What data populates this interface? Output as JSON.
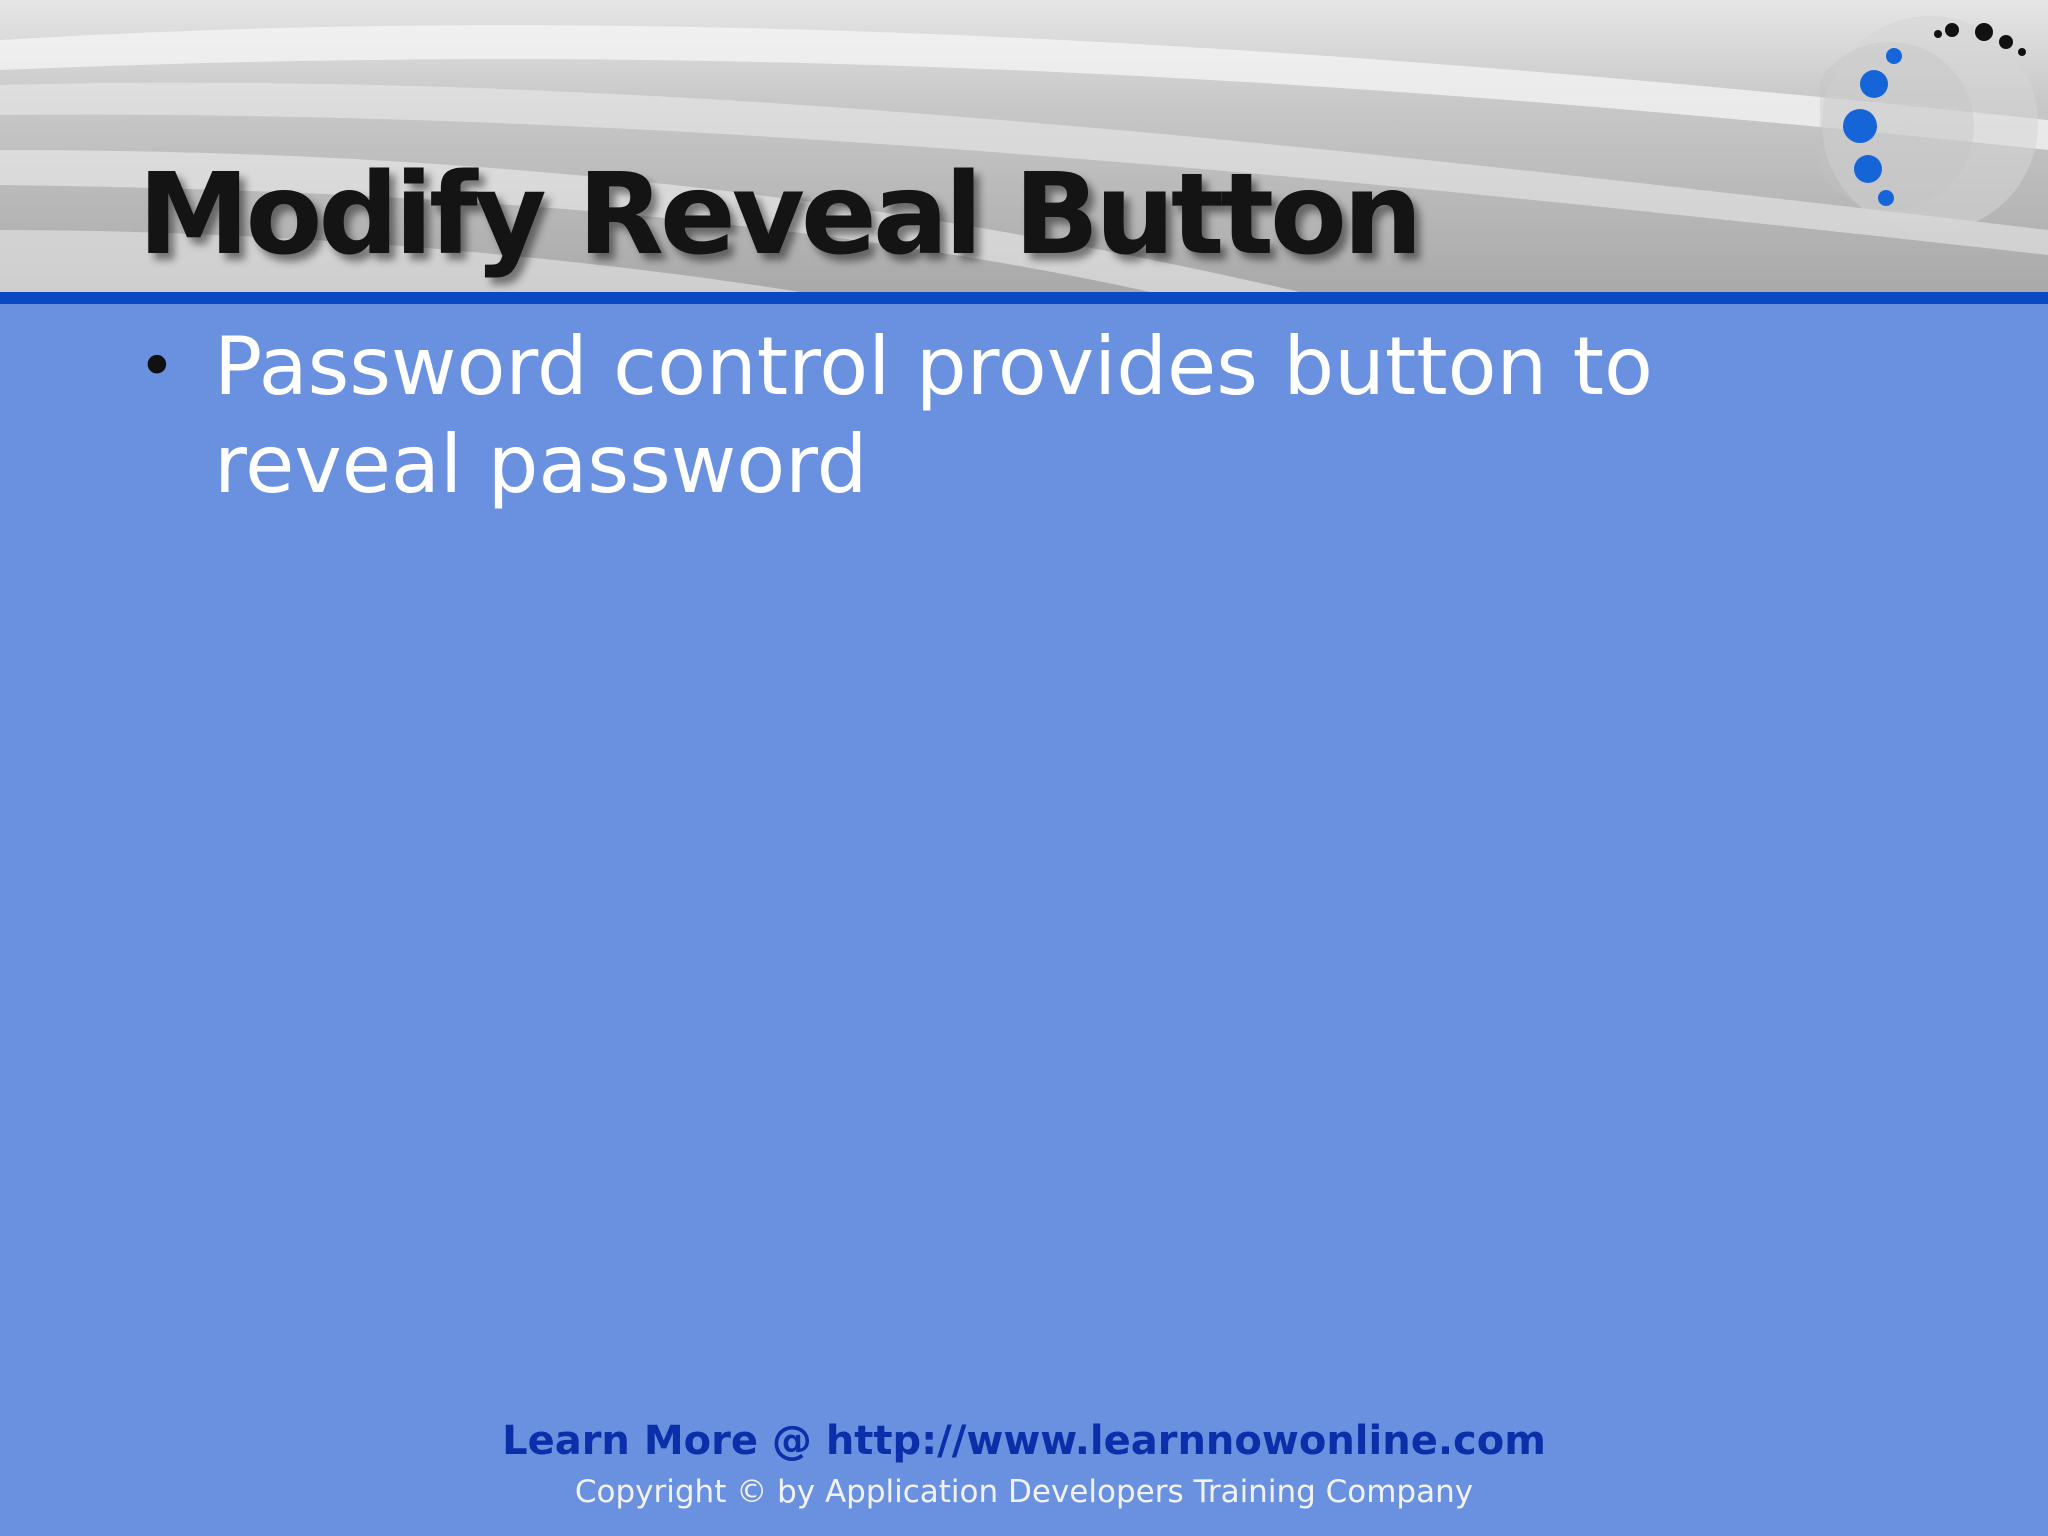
{
  "slide": {
    "title": "Modify Reveal Button",
    "bullets": [
      {
        "text": "Password control provides button to reveal password"
      }
    ]
  },
  "footer": {
    "link_text": "Learn More @ http://www.learnnowonline.com",
    "copyright": "Copyright © by Application Developers Training Company"
  },
  "colors": {
    "background": "#6a91e0",
    "header_rule": "#0b49c2",
    "footer_link": "#0a2fa8",
    "logo_dots": "#1565d8"
  },
  "icons": {
    "logo": "dotted-arc-logo-icon",
    "bullet": "bullet-dot-icon"
  }
}
